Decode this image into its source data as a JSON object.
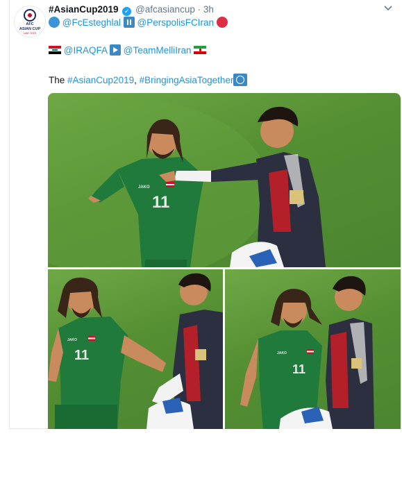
{
  "tweet": {
    "display_name": "#AsianCup2019",
    "handle": "@afcasiancup",
    "separator": "·",
    "time": "3h",
    "line1": {
      "mention_a": "@FcEsteghlal",
      "mention_b": "@PerspolisFCIran"
    },
    "line2": {
      "mention_a": "@IRAQFA",
      "mention_b": "@TeamMelliIran"
    },
    "body": {
      "prefix": "The ",
      "hashtag1": "#AsianCup2019",
      "comma": ", ",
      "hashtag2": "#BringingAsiaTogether"
    },
    "avatar_text": {
      "line1": "AFC",
      "line2": "ASIAN CUP",
      "line3": "UAE 2019"
    }
  },
  "icons": {
    "verified": "verified-check-icon",
    "menu": "chevron-down-icon",
    "esteghlal": "blue-circle-icon",
    "pause": "pause-button-icon",
    "perspolis": "red-circle-icon",
    "iraq_flag": "iraq-flag-icon",
    "play": "play-button-icon",
    "iran_flag": "iran-flag-icon",
    "globe": "globe-icon"
  },
  "jersey": {
    "green_number": "11",
    "sponsor": "JAKO"
  },
  "colors": {
    "link": "#1b95e0",
    "text": "#14171a",
    "muted": "#657786",
    "verified": "#1da1f2",
    "pitch": "#5a9438",
    "green_kit": "#1f7a3c",
    "keeper_kit": "#2b2f3f",
    "keeper_red": "#b3202a"
  }
}
